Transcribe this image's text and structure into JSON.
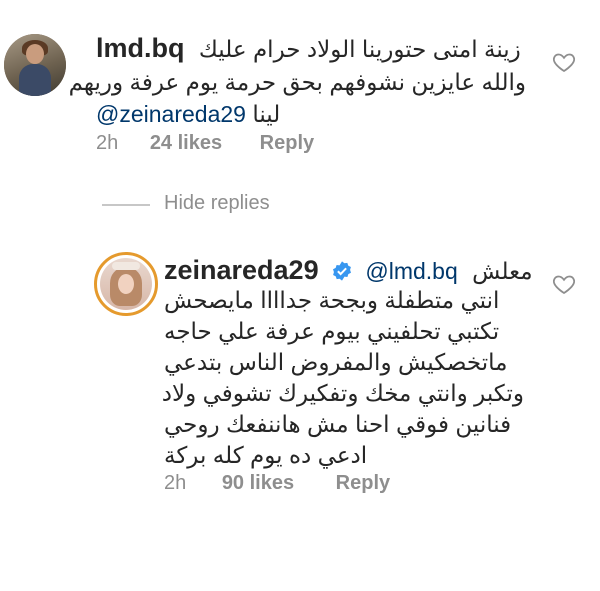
{
  "comment1": {
    "username": "lmd.bq",
    "line1": "زينة امتى حتورينا الولاد حرام عليك",
    "line2": "والله عايزين نشوفهم بحق حرمة يوم عرفة وريهم",
    "line3_text": "لينا",
    "line3_mention": "@zeinareda29",
    "time": "2h",
    "likes": "24 likes",
    "reply": "Reply"
  },
  "hide_replies": "Hide replies",
  "comment2": {
    "username": "zeinareda29",
    "mention": "@lmd.bq",
    "line1_text": "معلش",
    "lines": [
      "انتي متطفلة وبجحة جداااا مايصحش",
      "تكتبي تحلفيني بيوم عرفة علي حاجه",
      "ماتخصكيش والمفروض الناس بتدعي",
      "وتكبر وانتي مخك وتفكيرك تشوفي ولاد",
      "فنانين فوقي احنا مش هاننفعك روحي",
      "ادعي ده يوم كله بركة"
    ],
    "time": "2h",
    "likes": "90 likes",
    "reply": "Reply"
  },
  "colors": {
    "mention": "#00376b",
    "meta": "#8e8e8e",
    "story_ring": "#e59a2d",
    "verified": "#3897f0"
  },
  "icons": [
    "heart-icon",
    "verified-badge-icon"
  ]
}
